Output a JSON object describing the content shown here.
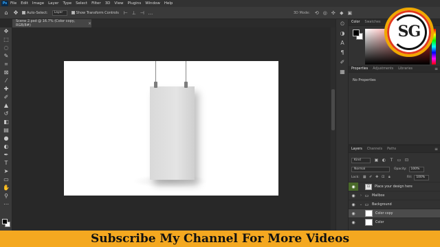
{
  "app": {
    "logo_text": "Ps"
  },
  "menu": [
    "File",
    "Edit",
    "Image",
    "Layer",
    "Type",
    "Select",
    "Filter",
    "3D",
    "View",
    "Plugins",
    "Window",
    "Help"
  ],
  "options": {
    "auto_select_label": "Auto-Select:",
    "auto_select_value": "Layer",
    "transform_label": "Show Transform Controls",
    "mode3d_label": "3D Mode:"
  },
  "document": {
    "tab_title": "Scene 2.psd @ 16.7% (Color copy, RGB/8#)",
    "close": "×"
  },
  "panels": {
    "color_tabs": [
      "Color",
      "Swatches"
    ],
    "props_tabs": [
      "Properties",
      "Adjustments",
      "Libraries"
    ],
    "no_properties": "No Properties",
    "layers_tabs": [
      "Layers",
      "Channels",
      "Paths"
    ]
  },
  "layers": {
    "kind_label": "Kind",
    "blend_mode": "Normal",
    "opacity_label": "Opacity:",
    "opacity_value": "100%",
    "lock_label": "Lock:",
    "fill_label": "Fill:",
    "fill_value": "100%",
    "items": [
      {
        "name": "Place your design here"
      },
      {
        "name": "Mailbox"
      },
      {
        "name": "Background"
      },
      {
        "name": "Color copy"
      },
      {
        "name": "Color"
      }
    ]
  },
  "logo": {
    "text": "SG",
    "colors": {
      "outer": "#f0a800",
      "inner": "#e23a1e"
    }
  },
  "banner": {
    "text": "Subscribe My Channel For More Videos",
    "color": "#f4a820"
  },
  "colors": {
    "workspace": "#282828",
    "panel": "#323232",
    "accent_layer_eye": "#4a6a2a"
  }
}
